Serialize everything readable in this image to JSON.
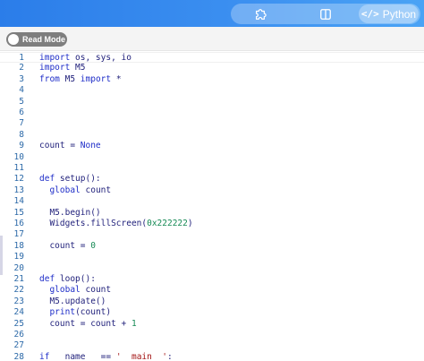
{
  "toolbar": {
    "plugin_icon": "puzzle-icon",
    "split_icon": "split-view-icon",
    "language_icon": "code-brackets-icon",
    "language_icon_glyph": "</>",
    "language_label": "Python"
  },
  "subbar": {
    "read_mode_label": "Read Mode"
  },
  "editor": {
    "lines": [
      {
        "n": "1",
        "text": "import os, sys, io"
      },
      {
        "n": "2",
        "text": "import M5"
      },
      {
        "n": "3",
        "text": "from M5 import *"
      },
      {
        "n": "4",
        "text": ""
      },
      {
        "n": "5",
        "text": ""
      },
      {
        "n": "6",
        "text": ""
      },
      {
        "n": "7",
        "text": ""
      },
      {
        "n": "8",
        "text": ""
      },
      {
        "n": "9",
        "text": "count = None"
      },
      {
        "n": "10",
        "text": ""
      },
      {
        "n": "11",
        "text": ""
      },
      {
        "n": "12",
        "text": "def setup():"
      },
      {
        "n": "13",
        "text": "  global count"
      },
      {
        "n": "14",
        "text": ""
      },
      {
        "n": "15",
        "text": "  M5.begin()"
      },
      {
        "n": "16",
        "text": "  Widgets.fillScreen(0x222222)"
      },
      {
        "n": "17",
        "text": ""
      },
      {
        "n": "18",
        "text": "  count = 0"
      },
      {
        "n": "19",
        "text": ""
      },
      {
        "n": "20",
        "text": ""
      },
      {
        "n": "21",
        "text": "def loop():"
      },
      {
        "n": "22",
        "text": "  global count"
      },
      {
        "n": "23",
        "text": "  M5.update()"
      },
      {
        "n": "24",
        "text": "  print(count)"
      },
      {
        "n": "25",
        "text": "  count = count + 1"
      },
      {
        "n": "26",
        "text": ""
      },
      {
        "n": "27",
        "text": ""
      },
      {
        "n": "28",
        "text": "if __name__ == '__main__':"
      }
    ]
  }
}
